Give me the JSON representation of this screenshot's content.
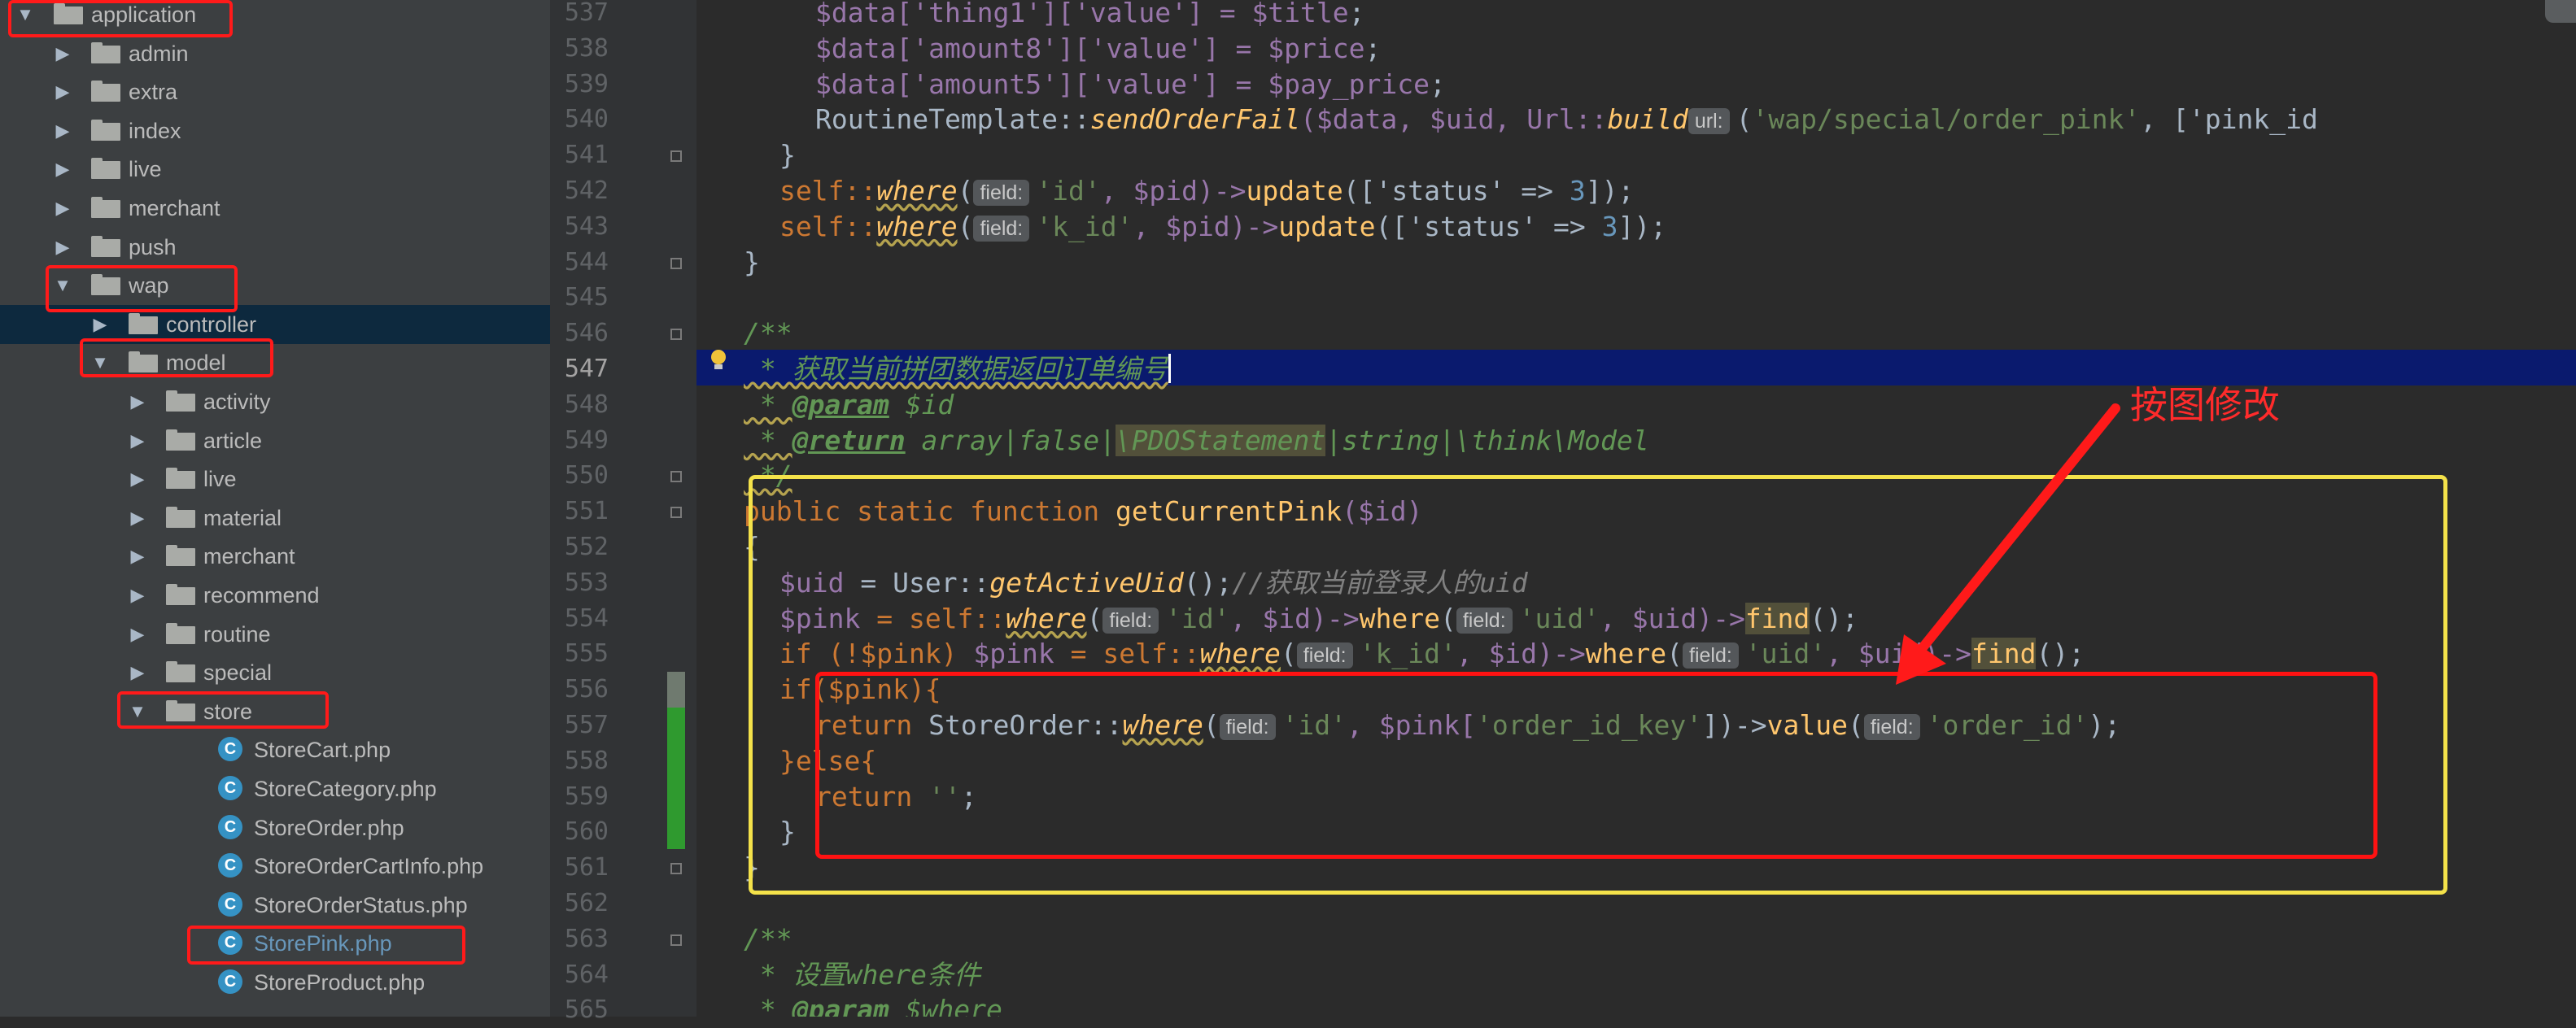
{
  "project_tree": {
    "items": [
      {
        "label": "application",
        "icon": "folder-icon",
        "expanded": true,
        "type": "folder"
      },
      {
        "label": "admin",
        "icon": "folder-icon",
        "expanded": false,
        "type": "folder"
      },
      {
        "label": "extra",
        "icon": "folder-icon",
        "expanded": false,
        "type": "folder"
      },
      {
        "label": "index",
        "icon": "folder-icon",
        "expanded": false,
        "type": "folder"
      },
      {
        "label": "live",
        "icon": "folder-icon",
        "expanded": false,
        "type": "folder"
      },
      {
        "label": "merchant",
        "icon": "folder-icon",
        "expanded": false,
        "type": "folder"
      },
      {
        "label": "push",
        "icon": "folder-icon",
        "expanded": false,
        "type": "folder"
      },
      {
        "label": "wap",
        "icon": "folder-icon",
        "expanded": true,
        "type": "folder"
      },
      {
        "label": "controller",
        "icon": "folder-icon",
        "expanded": false,
        "type": "folder"
      },
      {
        "label": "model",
        "icon": "folder-icon",
        "expanded": true,
        "type": "folder"
      },
      {
        "label": "activity",
        "icon": "folder-icon",
        "expanded": false,
        "type": "folder"
      },
      {
        "label": "article",
        "icon": "folder-icon",
        "expanded": false,
        "type": "folder"
      },
      {
        "label": "live",
        "icon": "folder-icon",
        "expanded": false,
        "type": "folder"
      },
      {
        "label": "material",
        "icon": "folder-icon",
        "expanded": false,
        "type": "folder"
      },
      {
        "label": "merchant",
        "icon": "folder-icon",
        "expanded": false,
        "type": "folder"
      },
      {
        "label": "recommend",
        "icon": "folder-icon",
        "expanded": false,
        "type": "folder"
      },
      {
        "label": "routine",
        "icon": "folder-icon",
        "expanded": false,
        "type": "folder"
      },
      {
        "label": "special",
        "icon": "folder-icon",
        "expanded": false,
        "type": "folder"
      },
      {
        "label": "store",
        "icon": "folder-icon",
        "expanded": true,
        "type": "folder"
      },
      {
        "label": "StoreCart.php",
        "icon": "php-class-icon",
        "type": "file"
      },
      {
        "label": "StoreCategory.php",
        "icon": "php-class-icon",
        "type": "file"
      },
      {
        "label": "StoreOrder.php",
        "icon": "php-class-icon",
        "type": "file"
      },
      {
        "label": "StoreOrderCartInfo.php",
        "icon": "php-class-icon",
        "type": "file"
      },
      {
        "label": "StoreOrderStatus.php",
        "icon": "php-class-icon",
        "type": "file"
      },
      {
        "label": "StorePink.php",
        "icon": "php-class-icon",
        "type": "file",
        "active": true
      },
      {
        "label": "StoreProduct.php",
        "icon": "php-class-icon",
        "type": "file"
      }
    ],
    "class_icon_letter": "C"
  },
  "gutter": {
    "line_numbers": [
      "537",
      "538",
      "539",
      "540",
      "541",
      "542",
      "543",
      "544",
      "545",
      "546",
      "547",
      "548",
      "549",
      "550",
      "551",
      "552",
      "553",
      "554",
      "555",
      "556",
      "557",
      "558",
      "559",
      "560",
      "561",
      "562",
      "563",
      "564",
      "565"
    ],
    "current_line": "547"
  },
  "code": {
    "hint_label": "field:",
    "url_hint_label": "url:",
    "lines": {
      "l537": [
        "$data['thing1']['value'] = ",
        "$title",
        ";"
      ],
      "l538": [
        "$data['amount8']['value'] = ",
        "$price",
        ";"
      ],
      "l539": [
        "$data['amount5']['value'] = ",
        "$pay_price",
        ";"
      ],
      "l540": [
        "RoutineTemplate::",
        "sendOrderFail",
        "($data, $uid, Url::",
        "build",
        "(",
        "'wap/special/order_pink'",
        ", ['pink_id"
      ],
      "l541": [
        "}"
      ],
      "l542": [
        "self::",
        "where",
        "(",
        "'id'",
        ", $pid)->",
        "update",
        "(['status' => ",
        "3",
        "]);"
      ],
      "l543": [
        "self::",
        "where",
        "(",
        "'k_id'",
        ", $pid)->",
        "update",
        "(['status' => ",
        "3",
        "]);"
      ],
      "l544": [
        "}"
      ],
      "l546": [
        "/**"
      ],
      "l547": [
        " * 获取当前拼团数据返回订单编号"
      ],
      "l548": [
        " * ",
        "@param",
        " $id"
      ],
      "l549": [
        " * ",
        "@return",
        " array|false|",
        "\\PDOStatement",
        "|string|\\think\\Model"
      ],
      "l550": [
        " */"
      ],
      "l551": [
        "public static function ",
        "getCurrentPink",
        "($id)"
      ],
      "l552": [
        "{"
      ],
      "l553": [
        "$uid",
        " = User::",
        "getActiveUid",
        "();",
        "//获取当前登录人的uid"
      ],
      "l554": [
        "$pink",
        " = self::",
        "where",
        "(",
        "'id'",
        ", $id)->",
        "where",
        "(",
        "'uid'",
        ", $uid)->",
        "find",
        "();"
      ],
      "l555": [
        "if (!$pink) ",
        "$pink",
        " = self::",
        "where",
        "(",
        "'k_id'",
        ", $id)->",
        "where",
        "(",
        "'uid'",
        ", $uid)->",
        "find",
        "();"
      ],
      "l556": [
        "if($pink){"
      ],
      "l557": [
        "return ",
        "StoreOrder::",
        "where",
        "(",
        "'id'",
        ", $pink[",
        "'order_id_key'",
        "])->",
        "value",
        "(",
        "'order_id'",
        ");"
      ],
      "l558": [
        "}else{"
      ],
      "l559": [
        "return ",
        "''",
        ";"
      ],
      "l560": [
        "}"
      ],
      "l561": [
        "}"
      ],
      "l563": [
        "/**"
      ],
      "l564": [
        " * 设置",
        "where",
        "条件"
      ],
      "l565": [
        " * ",
        "@param",
        " $where"
      ]
    }
  },
  "annotation": {
    "text": "按图修改",
    "color": "#ff1a1a"
  },
  "colors": {
    "keyword": "#cc7832",
    "variable": "#9876aa",
    "string": "#6a8759",
    "number": "#6897bb",
    "function": "#ffc66d",
    "comment": "#629755",
    "highlight_box": "#f4e24a",
    "red_box": "#ff1a1a"
  }
}
